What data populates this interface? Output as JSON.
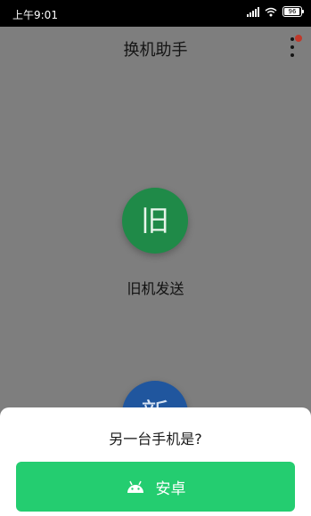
{
  "status_bar": {
    "time": "上午9:01",
    "battery_percent": 96,
    "battery_label": "96",
    "network": "signal-icon",
    "wifi": "wifi-icon"
  },
  "app_bar": {
    "title": "换机助手",
    "menu_icon": "more-vertical-icon",
    "has_notification_dot": true
  },
  "main": {
    "old_phone": {
      "glyph": "旧",
      "label": "旧机发送",
      "color": "#1f8a48"
    },
    "new_phone": {
      "glyph": "新",
      "color": "#20569e"
    }
  },
  "bottom_sheet": {
    "title": "另一台手机是?",
    "android_button": {
      "label": "安卓",
      "icon": "android-icon",
      "color": "#24cd70"
    }
  }
}
